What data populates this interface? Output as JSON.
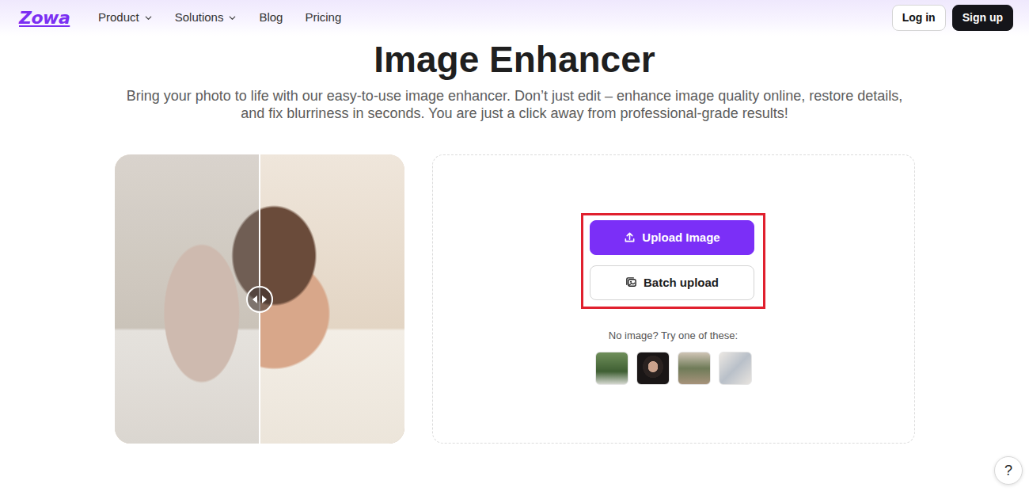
{
  "brand": {
    "logo": "Zowa"
  },
  "nav": {
    "items": [
      {
        "label": "Product",
        "kind": "dropdown"
      },
      {
        "label": "Solutions",
        "kind": "dropdown"
      },
      {
        "label": "Blog",
        "kind": "link"
      },
      {
        "label": "Pricing",
        "kind": "link"
      }
    ],
    "buttons": [
      {
        "label": "Log in",
        "kind": "outline"
      },
      {
        "label": "Sign up",
        "kind": "dark"
      }
    ]
  },
  "hero": {
    "title": "Image Enhancer",
    "subtitle": "Bring your photo to life with our easy-to-use image enhancer. Don’t just edit – enhance image quality online, restore details, and fix blurriness in seconds. You are just a click away from professional-grade results!"
  },
  "compare": {
    "level": 0.5
  },
  "upload": {
    "buttons": [
      {
        "label": "Upload Image",
        "kind": "primary"
      },
      {
        "label": "Batch upload",
        "kind": "outline"
      }
    ],
    "samples_label": "No image? Try one of these:"
  },
  "help": {
    "label": "?"
  }
}
